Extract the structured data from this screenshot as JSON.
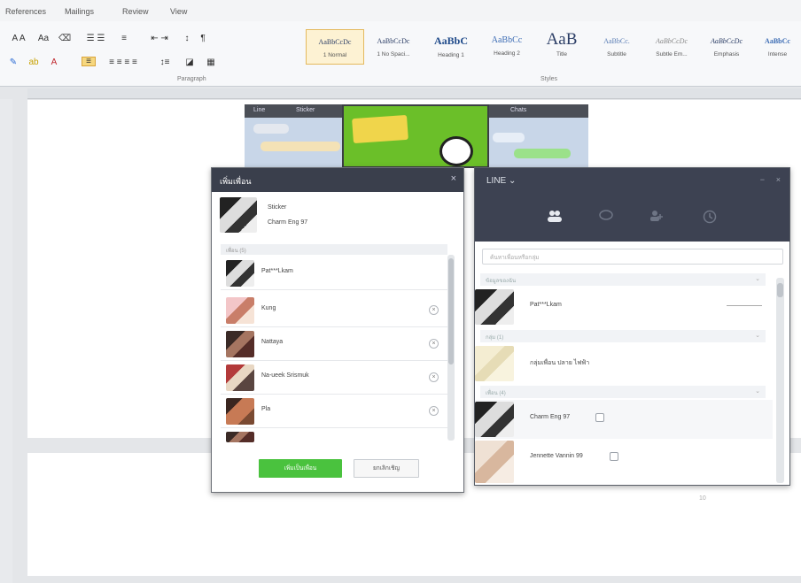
{
  "ribbon": {
    "tabs": [
      "References",
      "Mailings",
      "Review",
      "View"
    ],
    "styles": [
      {
        "preview": "AaBbCcDc",
        "name": "1 Normal"
      },
      {
        "preview": "AaBbCcDc",
        "name": "1 No Spaci..."
      },
      {
        "preview": "AaBbC",
        "name": "Heading 1"
      },
      {
        "preview": "AaBbCc",
        "name": "Heading 2"
      },
      {
        "preview": "AaB",
        "name": "Title"
      },
      {
        "preview": "AaBbCc.",
        "name": "Subtitle"
      },
      {
        "preview": "AaBbCcDc",
        "name": "Subtle Em..."
      },
      {
        "preview": "AaBbCcDc",
        "name": "Emphasis"
      },
      {
        "preview": "AaBbCc",
        "name": "Intense"
      }
    ],
    "group_labels": {
      "paragraph": "Paragraph",
      "styles": "Styles"
    }
  },
  "collage": {
    "header_left": "Line",
    "header_mid": "Sticker",
    "header_right": "Chats"
  },
  "invite_dialog": {
    "title": "เพิ่มเพื่อน",
    "close": "×",
    "profile": {
      "line1": "Sticker",
      "line2": "Charm Eng 97"
    },
    "section": "เพื่อน (5)",
    "friends": [
      {
        "name": "Pat***Lkam",
        "removable": false
      },
      {
        "name": "Kung",
        "removable": true
      },
      {
        "name": "Nattaya",
        "removable": true
      },
      {
        "name": "Na-ueek Srismuk",
        "removable": true
      },
      {
        "name": "Pla",
        "removable": true
      }
    ],
    "remove_glyph": "×",
    "primary_button": "เพิ่มเป็นเพื่อน",
    "secondary_button": "ยกเลิกเชิญ"
  },
  "line_window": {
    "title": "LINE ⌄",
    "window_controls": [
      "−",
      "×"
    ],
    "nav_icons": [
      "friends-icon",
      "chat-icon",
      "add-friend-icon",
      "history-icon"
    ],
    "search_placeholder": "ค้นหาเพื่อนหรือกลุ่ม",
    "sections": [
      "ข้อมูลของฉัน",
      "กลุ่ม (1)",
      "เพื่อน (4)"
    ],
    "entries": [
      {
        "name": "Pat***Lkam",
        "avatar": "dog"
      },
      {
        "name": "กลุ่มเพื่อน ปลาย ไฟฟ้า",
        "avatar": "map"
      },
      {
        "name": "Charm Eng 97",
        "avatar": "dog"
      },
      {
        "name": "Jennette Vannin 99",
        "avatar": "baby"
      }
    ]
  },
  "page_number": "10"
}
